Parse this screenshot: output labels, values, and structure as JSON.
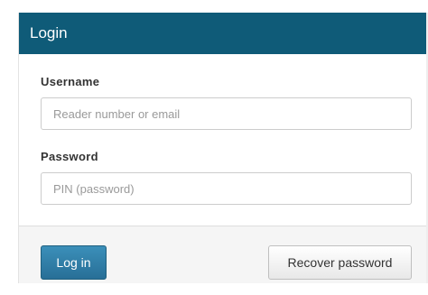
{
  "login_panel": {
    "title": "Login",
    "username": {
      "label": "Username",
      "value": "",
      "placeholder": "Reader number or email"
    },
    "password": {
      "label": "Password",
      "value": "",
      "placeholder": "PIN (password)"
    },
    "buttons": {
      "login_label": "Log in",
      "recover_label": "Recover password"
    }
  },
  "colors": {
    "header_background": "#0f5b78",
    "login_button": "#286f97",
    "footer_background": "#f5f5f5"
  }
}
